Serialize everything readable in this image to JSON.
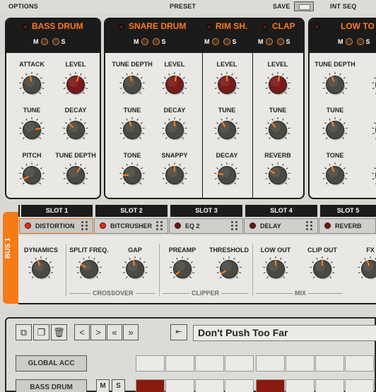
{
  "topbar": {
    "options": "OPTIONS",
    "preset": "PRESET",
    "save": "SAVE",
    "int_seq": "INT SEQ"
  },
  "sections": {
    "bass_drum": {
      "title": "BASS DRUM",
      "m": "M",
      "s": "S",
      "knobs": {
        "attack": "ATTACK",
        "level": "LEVEL",
        "tune": "TUNE",
        "decay": "DECAY",
        "pitch": "PITCH",
        "tune_depth": "TUNE DEPTH"
      }
    },
    "snare_drum": {
      "title": "SNARE DRUM",
      "m": "M",
      "s": "S",
      "knobs": {
        "tune_depth": "TUNE DEPTH",
        "level": "LEVEL",
        "tune": "TUNE",
        "decay": "DECAY",
        "tone": "TONE",
        "snappy": "SNAPPY"
      }
    },
    "rim_shot": {
      "title": "RIM SH.",
      "knobs": {
        "level": "LEVEL",
        "tune": "TUNE",
        "decay": "DECAY"
      }
    },
    "clap": {
      "title": "CLAP",
      "knobs": {
        "level": "LEVEL",
        "tune": "TUNE",
        "reverb": "REVERB"
      }
    },
    "low_tom": {
      "title": "LOW TO",
      "m": "M",
      "s": "S",
      "knobs": {
        "tune_depth": "TUNE DEPTH",
        "level": "LE",
        "tune": "TUNE",
        "decay": "DE",
        "tone": "TONE",
        "tune2": "TUNE"
      }
    }
  },
  "bus": {
    "label": "BUS 1",
    "swap_icon": "⇄",
    "slots": [
      {
        "header": "SLOT 1",
        "effect": "DISTORTION",
        "active": true
      },
      {
        "header": "SLOT 2",
        "effect": "BITCRUSHER",
        "active": true
      },
      {
        "header": "SLOT 3",
        "effect": "EQ 2",
        "active": false
      },
      {
        "header": "SLOT 4",
        "effect": "DELAY",
        "active": false
      },
      {
        "header": "SLOT 5",
        "effect": "REVERB",
        "active": false
      }
    ],
    "params": {
      "dynamics": "DYNAMICS",
      "split_freq": "SPLIT FREQ.",
      "gap": "GAP",
      "preamp": "PREAMP",
      "threshold": "THRESHOLD",
      "low_out": "LOW OUT",
      "clip_out": "CLIP OUT",
      "fx": "FX"
    },
    "groups": {
      "crossover": "CROSSOVER",
      "clipper": "CLIPPER",
      "mix": "MIX"
    }
  },
  "sequencer": {
    "pattern_name": "Don't Push Too Far",
    "nav": {
      "prev": "<",
      "next": ">",
      "first": "«",
      "last": "»"
    },
    "rows": [
      {
        "label": "GLOBAL ACC"
      },
      {
        "label": "BASS DRUM",
        "m": "M",
        "s": "S"
      }
    ],
    "steps_global": [
      false,
      false,
      false,
      false,
      false,
      false,
      false,
      false
    ],
    "steps_bass": [
      true,
      false,
      false,
      false,
      true,
      false,
      false,
      false
    ]
  },
  "colors": {
    "accent": "#ff7a1a",
    "knob_dark": "#4a4a42",
    "knob_red": "#7a1a1a",
    "panel": "#e9e8e4"
  }
}
